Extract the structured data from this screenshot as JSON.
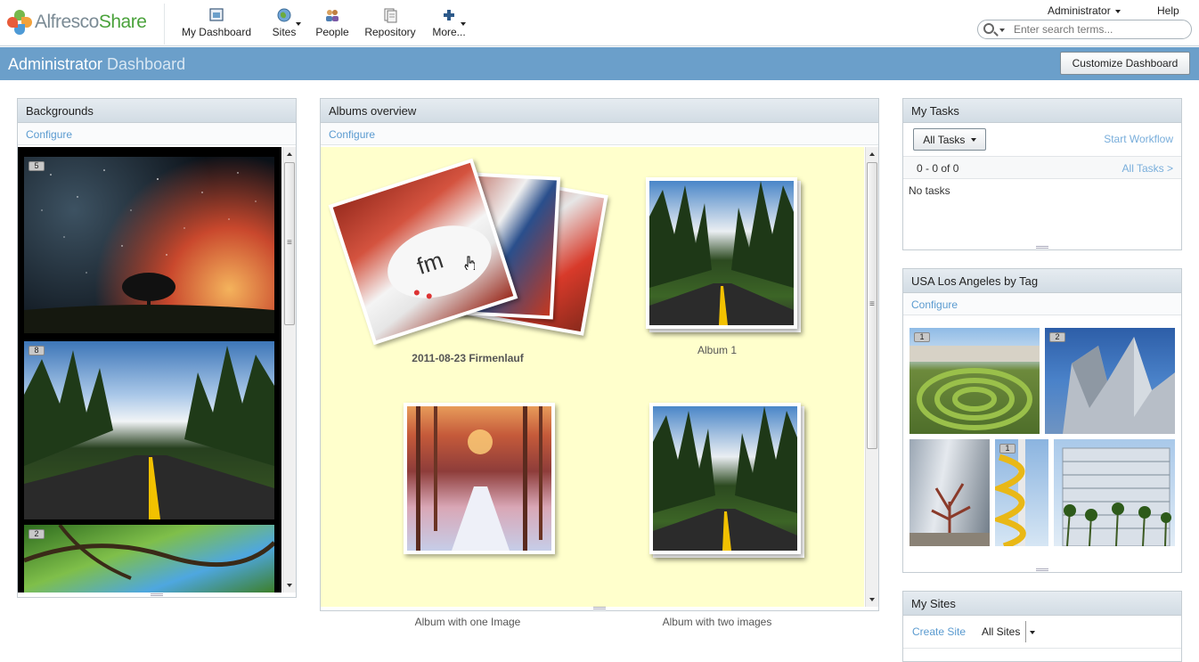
{
  "header": {
    "app_name_part1": "Alfresco",
    "app_name_part2": "Share",
    "nav": [
      {
        "label": "My Dashboard",
        "icon": "dashboard-icon"
      },
      {
        "label": "Sites",
        "icon": "globe-icon"
      },
      {
        "label": "People",
        "icon": "people-icon"
      },
      {
        "label": "Repository",
        "icon": "repository-icon"
      },
      {
        "label": "More...",
        "icon": "plus-icon"
      }
    ],
    "user_menu": "Administrator",
    "help": "Help",
    "search_placeholder": "Enter search terms..."
  },
  "title_bar": {
    "user": "Administrator",
    "page": "Dashboard",
    "customize_button": "Customize Dashboard"
  },
  "backgrounds": {
    "title": "Backgrounds",
    "configure": "Configure",
    "images": [
      {
        "badge": "5"
      },
      {
        "badge": "8"
      },
      {
        "badge": "2"
      }
    ]
  },
  "albums": {
    "title": "Albums overview",
    "configure": "Configure",
    "items": [
      {
        "label": "2011-08-23 Firmenlauf"
      },
      {
        "label": "Album 1"
      },
      {
        "label": "Album with one Image"
      },
      {
        "label": "Album with two images"
      }
    ]
  },
  "tasks": {
    "title": "My Tasks",
    "filter": "All Tasks",
    "start_workflow": "Start Workflow",
    "paging": "0 - 0 of 0",
    "all_tasks": "All Tasks >",
    "empty": "No tasks"
  },
  "tag": {
    "title": "USA Los Angeles by Tag",
    "configure": "Configure",
    "images": [
      {
        "badge": "1"
      },
      {
        "badge": "2"
      },
      {
        "badge": ""
      },
      {
        "badge": "1"
      },
      {
        "badge": ""
      }
    ]
  },
  "sites": {
    "title": "My Sites",
    "create": "Create Site",
    "filter": "All Sites"
  },
  "colors": {
    "accent": "#6b9fca",
    "link": "#5b9bd0",
    "album_bg": "#ffffcc"
  }
}
